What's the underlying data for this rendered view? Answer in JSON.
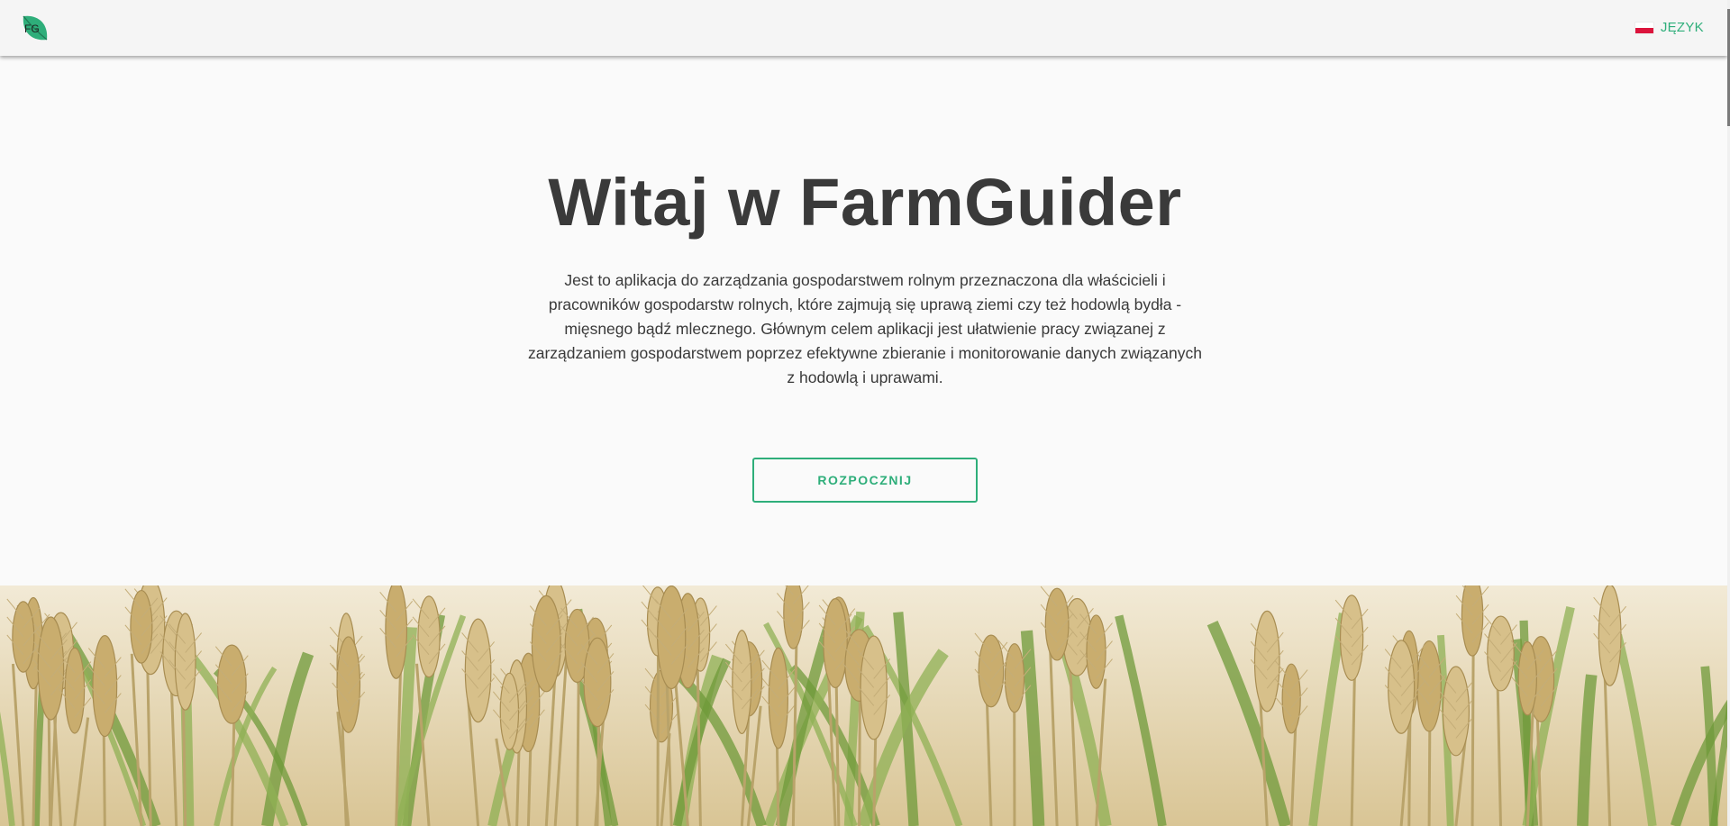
{
  "header": {
    "logo_text": "FG",
    "logo_icon": "leaf-icon",
    "language_label": "JĘZYK",
    "language_flag": "poland-flag-icon"
  },
  "hero": {
    "title": "Witaj w FarmGuider",
    "description": "Jest to aplikacja do zarządzania gospodarstwem rolnym przeznaczona dla właścicieli i pracowników gospodarstw rolnych, które zajmują się uprawą ziemi czy też hodowlą bydła - mięsnego bądź mlecznego. Głównym celem aplikacji jest ułatwienie pracy związanej z zarządzaniem gospodarstwem poprzez efektywne zbieranie i monitorowanie danych związanych z hodowlą i uprawami.",
    "start_button_label": "ROZPOCZNIJ"
  },
  "banner": {
    "image": "wheat-field-image"
  },
  "colors": {
    "accent": "#2eae7a",
    "text": "#3a3a3a",
    "background": "#fafafa",
    "header_bg": "#f5f5f5"
  }
}
